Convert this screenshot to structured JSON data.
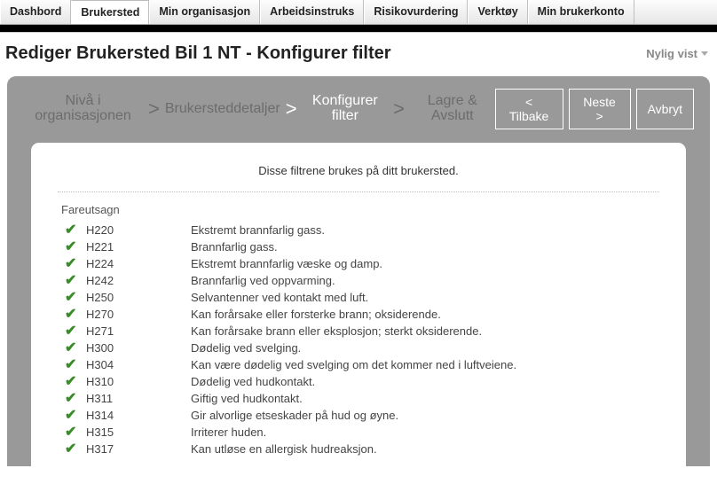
{
  "menu": {
    "items": [
      {
        "label": "Dashbord",
        "active": false
      },
      {
        "label": "Brukersted",
        "active": true
      },
      {
        "label": "Min organisasjon",
        "active": false
      },
      {
        "label": "Arbeidsinstruks",
        "active": false
      },
      {
        "label": "Risikovurdering",
        "active": false
      },
      {
        "label": "Verktøy",
        "active": false
      },
      {
        "label": "Min brukerkonto",
        "active": false
      }
    ]
  },
  "header": {
    "title": "Rediger Brukersted Bil 1 NT - Konfigurer filter",
    "recent_label": "Nylig vist"
  },
  "wizard": {
    "crumbs": [
      {
        "label": "Nivå i organisasjonen",
        "current": false
      },
      {
        "label": "Brukersteddetaljer",
        "current": false
      },
      {
        "label": "Konfigurer filter",
        "current": true
      },
      {
        "label": "Lagre & Avslutt",
        "current": false
      }
    ],
    "actions": {
      "back": "< Tilbake",
      "next": "Neste >",
      "cancel": "Avbryt"
    }
  },
  "content": {
    "intro": "Disse filtrene brukes på ditt brukersted.",
    "section_label": "Fareutsagn",
    "items": [
      {
        "code": "H220",
        "desc": "Ekstremt brannfarlig gass."
      },
      {
        "code": "H221",
        "desc": "Brannfarlig gass."
      },
      {
        "code": "H224",
        "desc": "Ekstremt brannfarlig væske og damp."
      },
      {
        "code": "H242",
        "desc": "Brannfarlig ved oppvarming."
      },
      {
        "code": "H250",
        "desc": "Selvantenner ved kontakt med luft."
      },
      {
        "code": "H270",
        "desc": "Kan forårsake eller forsterke brann; oksiderende."
      },
      {
        "code": "H271",
        "desc": "Kan forårsake brann eller eksplosjon; sterkt oksiderende."
      },
      {
        "code": "H300",
        "desc": "Dødelig ved svelging."
      },
      {
        "code": "H304",
        "desc": "Kan være dødelig ved svelging om det kommer ned i luftveiene."
      },
      {
        "code": "H310",
        "desc": "Dødelig ved hudkontakt."
      },
      {
        "code": "H311",
        "desc": "Giftig ved hudkontakt."
      },
      {
        "code": "H314",
        "desc": "Gir alvorlige etseskader på hud og øyne."
      },
      {
        "code": "H315",
        "desc": "Irriterer huden."
      },
      {
        "code": "H317",
        "desc": "Kan utløse en allergisk hudreaksjon."
      }
    ]
  }
}
